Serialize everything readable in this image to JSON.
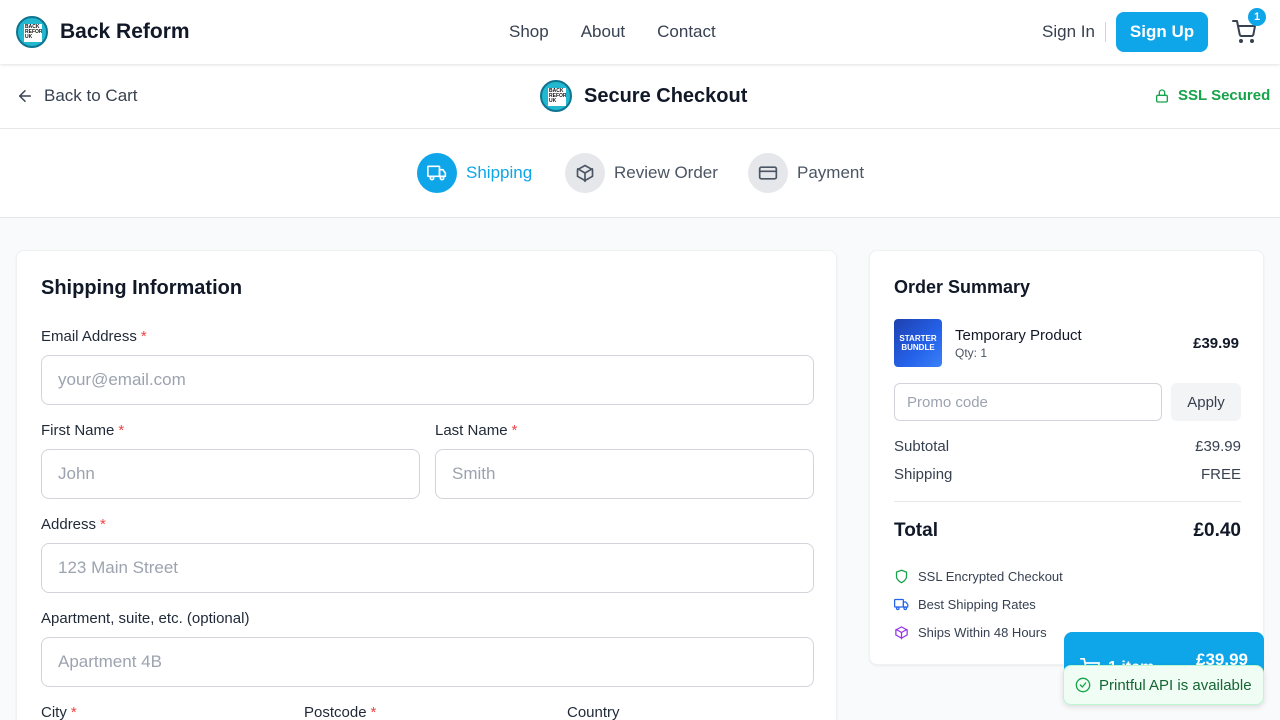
{
  "navbar": {
    "brand_name": "Back Reform",
    "logo_text": "BACK REFORM UK",
    "links": [
      "Shop",
      "About",
      "Contact"
    ],
    "sign_in": "Sign In",
    "sign_up": "Sign Up",
    "cart_count": "1"
  },
  "checkout_header": {
    "back_label": "Back to Cart",
    "title": "Secure Checkout",
    "ssl_label": "SSL Secured"
  },
  "steps": [
    {
      "label": "Shipping",
      "state": "active",
      "icon": "truck-icon"
    },
    {
      "label": "Review Order",
      "state": "inactive",
      "icon": "package-icon"
    },
    {
      "label": "Payment",
      "state": "inactive",
      "icon": "credit-card-icon"
    }
  ],
  "shipping_form": {
    "title": "Shipping Information",
    "email": {
      "label": "Email Address",
      "placeholder": "your@email.com",
      "required": true
    },
    "first_name": {
      "label": "First Name",
      "placeholder": "John",
      "required": true
    },
    "last_name": {
      "label": "Last Name",
      "placeholder": "Smith",
      "required": true
    },
    "address": {
      "label": "Address",
      "placeholder": "123 Main Street",
      "required": true
    },
    "apartment": {
      "label": "Apartment, suite, etc. (optional)",
      "placeholder": "Apartment 4B"
    },
    "city": {
      "label": "City",
      "required": true
    },
    "postcode": {
      "label": "Postcode",
      "required": true
    },
    "country": {
      "label": "Country"
    },
    "required_mark": "*"
  },
  "order_summary": {
    "title": "Order Summary",
    "product": {
      "thumb_text": "STARTER BUNDLE",
      "name": "Temporary Product",
      "qty": "Qty: 1",
      "price": "£39.99"
    },
    "promo_placeholder": "Promo code",
    "apply_label": "Apply",
    "subtotal_label": "Subtotal",
    "subtotal_value": "£39.99",
    "shipping_label": "Shipping",
    "shipping_value": "FREE",
    "total_label": "Total",
    "total_value": "£0.40",
    "features": [
      {
        "label": "SSL Encrypted Checkout",
        "icon": "shield-icon"
      },
      {
        "label": "Best Shipping Rates",
        "icon": "truck-icon"
      },
      {
        "label": "Ships Within 48 Hours",
        "icon": "package-icon"
      }
    ]
  },
  "floating_cart": {
    "items_label": "1 item",
    "price": "£39.99"
  },
  "toast": {
    "message": "Printful API is available"
  },
  "colors": {
    "accent": "#0ea5e9",
    "success": "#16a34a",
    "required": "#ef4444"
  }
}
